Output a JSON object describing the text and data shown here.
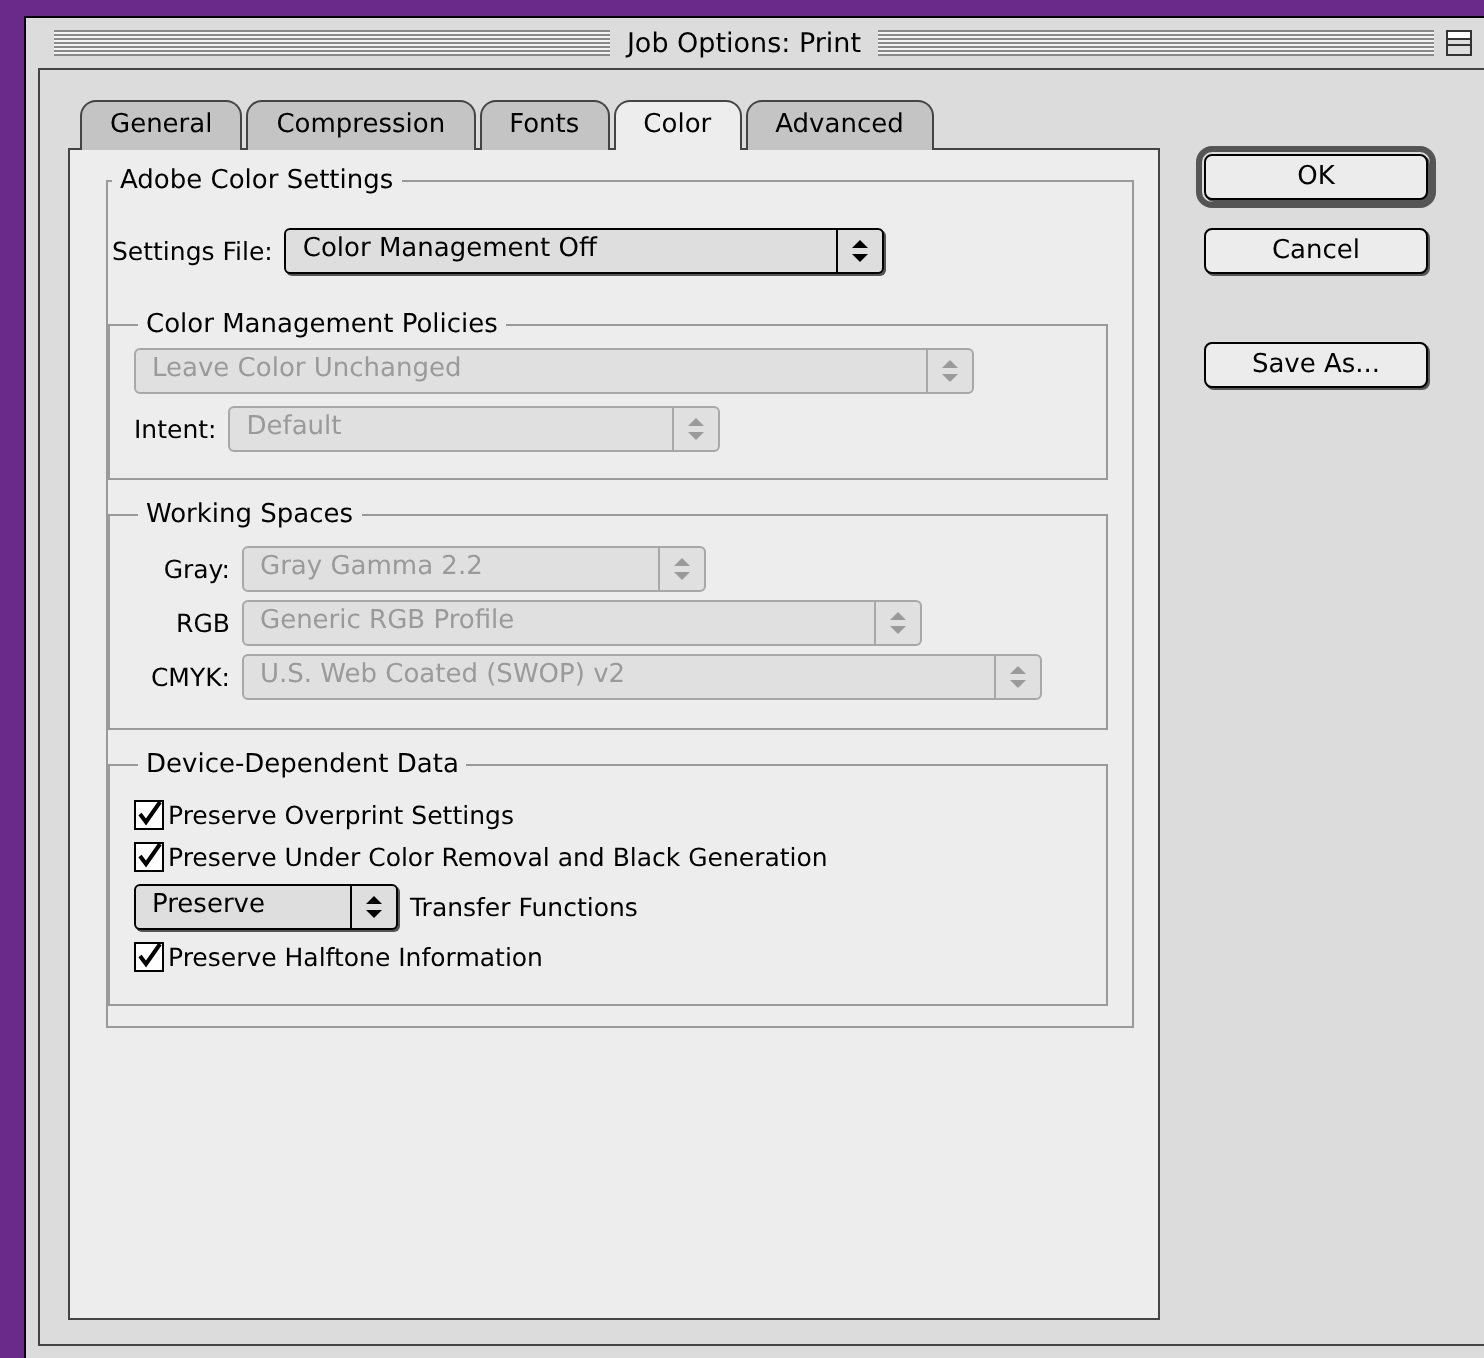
{
  "window": {
    "title": "Job Options: Print"
  },
  "tabs": [
    {
      "label": "General",
      "selected": false
    },
    {
      "label": "Compression",
      "selected": false
    },
    {
      "label": "Fonts",
      "selected": false
    },
    {
      "label": "Color",
      "selected": true
    },
    {
      "label": "Advanced",
      "selected": false
    }
  ],
  "color_settings": {
    "title": "Adobe Color Settings",
    "settings_file": {
      "label": "Settings File:",
      "value": "Color Management Off",
      "disabled": false
    },
    "policies": {
      "title": "Color Management Policies",
      "policy": {
        "value": "Leave Color Unchanged",
        "disabled": true
      },
      "intent": {
        "label": "Intent:",
        "value": "Default",
        "disabled": true
      }
    },
    "working_spaces": {
      "title": "Working Spaces",
      "rows": [
        {
          "label": "Gray:",
          "value": "Gray Gamma 2.2",
          "disabled": true
        },
        {
          "label": "RGB",
          "value": "Generic RGB Profile",
          "disabled": true
        },
        {
          "label": "CMYK:",
          "value": "U.S. Web Coated (SWOP) v2",
          "disabled": true
        }
      ]
    },
    "device_data": {
      "title": "Device-Dependent Data",
      "items": [
        {
          "kind": "checkbox",
          "label": "Preserve Overprint Settings",
          "checked": true
        },
        {
          "kind": "checkbox",
          "label": "Preserve Under Color Removal and Black Generation",
          "checked": true
        },
        {
          "kind": "dropdown",
          "value": "Preserve",
          "disabled": false,
          "trailing_text": "Transfer Functions"
        },
        {
          "kind": "checkbox",
          "label": "Preserve Halftone Information",
          "checked": true
        }
      ]
    }
  },
  "buttons": [
    {
      "label": "OK",
      "default": true
    },
    {
      "label": "Cancel",
      "default": false
    },
    {
      "label": "Save As...",
      "default": false
    }
  ]
}
